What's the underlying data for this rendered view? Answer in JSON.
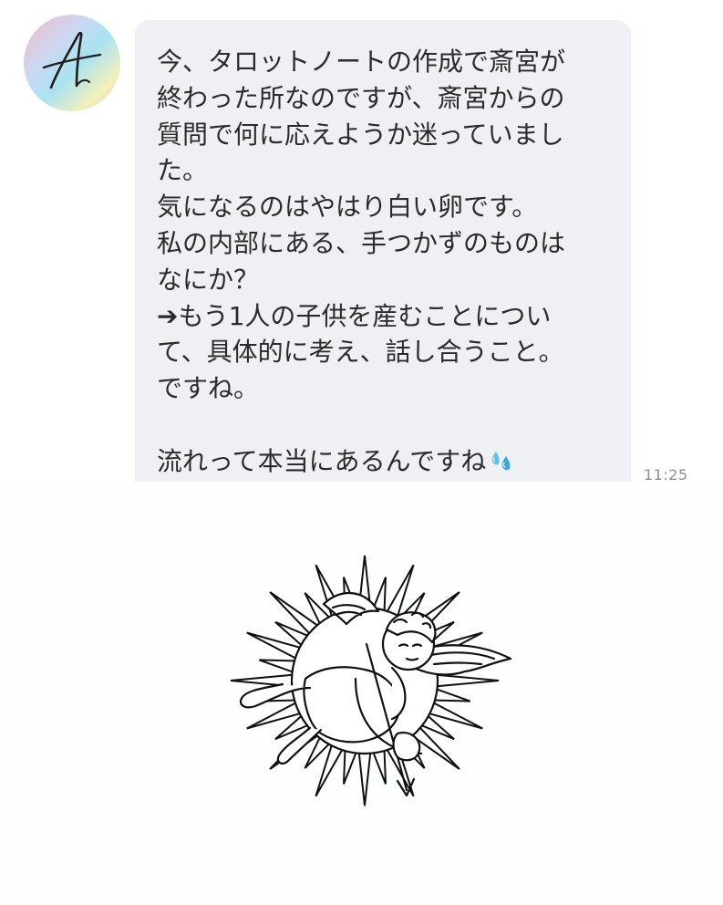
{
  "message": {
    "avatar_letter": "A",
    "lines": [
      "今、タロットノートの作成で斎宮が",
      "終わった所なのですが、斎宮からの",
      "質問で何に応えようか迷っていまし",
      "た。",
      "気になるのはやはり白い卵です。",
      "私の内部にある、手つかずのものは",
      "なにか？",
      "➔もう1人の子供を産むことについ",
      "て、具体的に考え、話し合うこと。",
      "ですね。",
      "",
      "流れって本当にあるんですね"
    ],
    "emoji_icon": "sweat-droplets-icon",
    "timestamp": "11:25"
  },
  "illustration": {
    "icon": "cupid-sunburst-icon"
  },
  "colors": {
    "bubble_bg": "#eef0f3",
    "text": "#2b2b2b",
    "timestamp": "#8a8f96",
    "drops": "#5bc0eb"
  }
}
